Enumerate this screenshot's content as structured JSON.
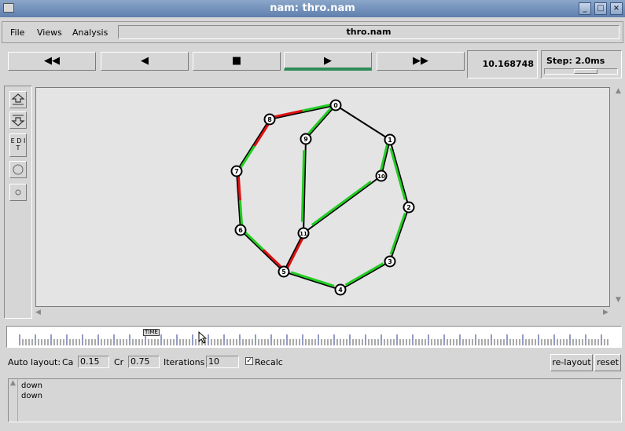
{
  "window": {
    "title": "nam: thro.nam"
  },
  "menu": {
    "file": "File",
    "views": "Views",
    "analysis": "Analysis",
    "filename": "thro.nam"
  },
  "transport": {
    "buttons": [
      {
        "name": "fast-rewind",
        "glyph": "◀◀"
      },
      {
        "name": "rewind",
        "glyph": "◀"
      },
      {
        "name": "stop",
        "glyph": "■"
      },
      {
        "name": "play",
        "glyph": "▶"
      },
      {
        "name": "fast-forward",
        "glyph": "▶▶"
      }
    ],
    "time": "10.168748",
    "step_label": "Step: 2.0ms"
  },
  "sidebar": {
    "edit_label": "E D I T"
  },
  "timeline": {
    "marker": "TIME"
  },
  "autolayout": {
    "label": "Auto layout:",
    "ca_label": "Ca",
    "ca_value": "0.15",
    "cr_label": "Cr",
    "cr_value": "0.75",
    "iter_label": "Iterations",
    "iter_value": "10",
    "recalc_label": "Recalc",
    "recalc_checked": "✓",
    "relayout_label": "re-layout",
    "reset_label": "reset"
  },
  "log": {
    "lines": [
      "down",
      "down"
    ]
  },
  "network": {
    "nodes": [
      "0",
      "1",
      "2",
      "3",
      "4",
      "5",
      "6",
      "7",
      "8",
      "9",
      "10",
      "11"
    ],
    "links": [
      {
        "from": "0",
        "to": "8",
        "colors": [
          "green",
          "red"
        ]
      },
      {
        "from": "0",
        "to": "1",
        "colors": []
      },
      {
        "from": "0",
        "to": "9",
        "colors": [
          "green"
        ]
      },
      {
        "from": "1",
        "to": "10",
        "colors": [
          "green"
        ]
      },
      {
        "from": "1",
        "to": "2",
        "colors": [
          "green"
        ]
      },
      {
        "from": "2",
        "to": "3",
        "colors": [
          "green"
        ]
      },
      {
        "from": "3",
        "to": "4",
        "colors": [
          "green"
        ]
      },
      {
        "from": "4",
        "to": "5",
        "colors": [
          "green"
        ]
      },
      {
        "from": "5",
        "to": "6",
        "colors": [
          "red",
          "green"
        ]
      },
      {
        "from": "5",
        "to": "11",
        "colors": [
          "red"
        ]
      },
      {
        "from": "6",
        "to": "7",
        "colors": [
          "green",
          "red"
        ]
      },
      {
        "from": "7",
        "to": "8",
        "colors": [
          "green",
          "red"
        ]
      },
      {
        "from": "9",
        "to": "11",
        "colors": [
          "green"
        ]
      },
      {
        "from": "10",
        "to": "11",
        "colors": [
          "green"
        ]
      }
    ],
    "colors": {
      "green": "#22cc22",
      "red": "#dd1111",
      "link": "#000000",
      "background": "#e4e4e4"
    }
  }
}
